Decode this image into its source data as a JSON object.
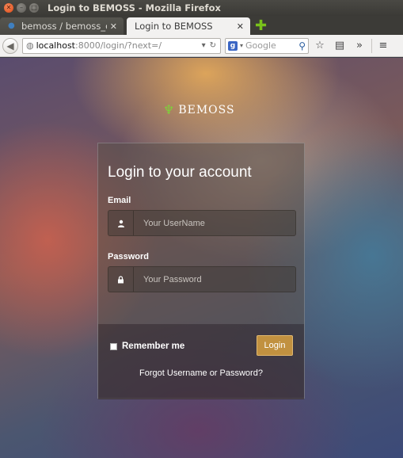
{
  "window": {
    "title": "Login to BEMOSS - Mozilla Firefox"
  },
  "tabs": [
    {
      "label": "bemoss / bemoss_o...",
      "active": false
    },
    {
      "label": "Login to BEMOSS",
      "active": true
    }
  ],
  "nav": {
    "url_host": "localhost",
    "url_rest": ":8000/login/?next=/",
    "search_placeholder": "Google",
    "search_engine_badge": "g"
  },
  "page": {
    "brand": "BEMOSS",
    "title": "Login to your account",
    "email_label": "Email",
    "email_placeholder": "Your UserName",
    "password_label": "Password",
    "password_placeholder": "Your Password",
    "remember_label": "Remember me",
    "login_label": "Login",
    "forgot_label": "Forgot Username or Password?"
  },
  "colors": {
    "accent_button": "#c19140",
    "brand_icon": "#7ed13a"
  }
}
